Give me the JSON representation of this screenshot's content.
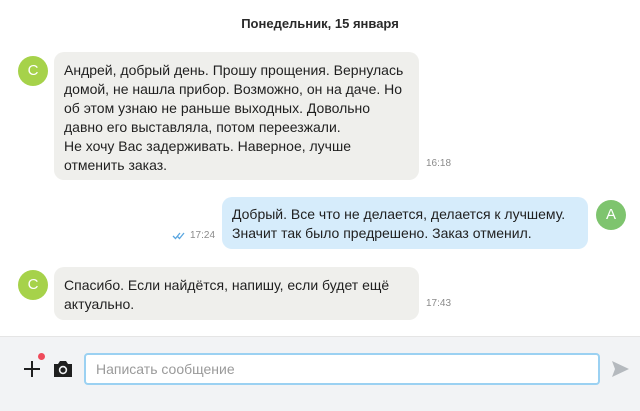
{
  "chat": {
    "date_header": "Понедельник, 15 января",
    "messages": [
      {
        "direction": "incoming",
        "avatar_letter": "С",
        "text": "Андрей, добрый день. Прошу прощения. Вернулась\nдомой, не нашла прибор. Возможно, он на даче. Но\nоб этом узнаю не раньше выходных. Довольно\nдавно его выставляла, потом переезжали.\nНе хочу Вас задерживать. Наверное, лучше\nотменить заказ.",
        "time": "16:18"
      },
      {
        "direction": "outgoing",
        "avatar_letter": "А",
        "text": "Добрый. Все что не делается, делается к лучшему.\nЗначит так было предрешено. Заказ отменил.",
        "time": "17:24",
        "status_icon": "double-check-icon"
      },
      {
        "direction": "incoming",
        "avatar_letter": "С",
        "text": "Спасибо. Если найдётся, напишу, если будет ещё\nактуально.",
        "time": "17:43"
      }
    ]
  },
  "composer": {
    "placeholder": "Написать сообщение",
    "value": "",
    "icons": {
      "attach": "plus-icon",
      "camera": "camera-icon",
      "send": "send-icon",
      "notification": "red-dot-badge"
    }
  },
  "colors": {
    "incoming_bubble": "#efefec",
    "outgoing_bubble": "#d6ecfb",
    "incoming_avatar": "#a6d24a",
    "outgoing_avatar": "#7ec46e",
    "input_border": "#9bd1f2",
    "notification_dot": "#ef4b5b",
    "read_checks": "#5aa6e0"
  }
}
